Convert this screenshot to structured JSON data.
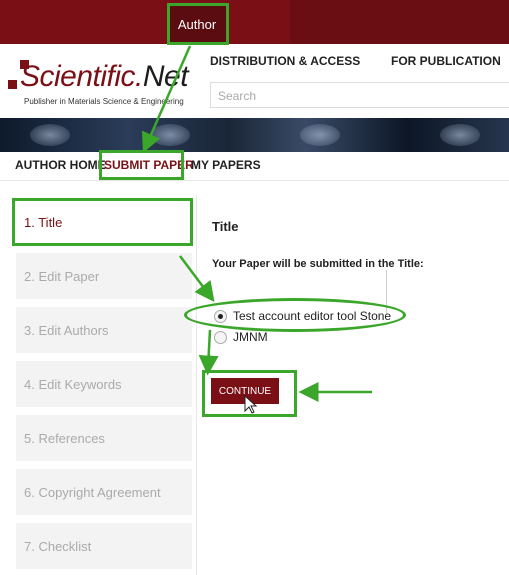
{
  "topbar": {
    "author_tab": "Author"
  },
  "header": {
    "logo": {
      "wordmark_main": "Scientific.",
      "wordmark_accent": "Net",
      "tagline": "Publisher in Materials Science & Engineering"
    },
    "nav": {
      "distribution": "DISTRIBUTION & ACCESS",
      "publication": "FOR PUBLICATION"
    },
    "search": {
      "placeholder": "Search"
    }
  },
  "subnav": {
    "items": [
      "AUTHOR HOME",
      "SUBMIT PAPER",
      "MY PAPERS"
    ],
    "active_index": 1
  },
  "steps": [
    "1. Title",
    "2. Edit Paper",
    "3. Edit Authors",
    "4. Edit Keywords",
    "5. References",
    "6. Copyright Agreement",
    "7. Checklist"
  ],
  "panel": {
    "title": "Title",
    "label": "Your Paper will be submitted in the Title:",
    "options": [
      {
        "label": "Test account editor tool Stone",
        "checked": true
      },
      {
        "label": "JMNM",
        "checked": false
      }
    ],
    "continue_label": "CONTINUE"
  },
  "colors": {
    "brand": "#7a1016",
    "annotation": "#3aa62a"
  }
}
